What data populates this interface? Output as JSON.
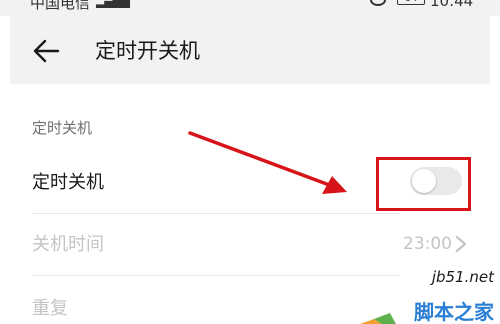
{
  "status_bar": {
    "carrier": "中国电信",
    "battery": "64",
    "time": "10:44"
  },
  "header": {
    "title": "定时开关机"
  },
  "section": {
    "title": "定时关机"
  },
  "rows": [
    {
      "label": "定时关机",
      "toggle_on": false
    },
    {
      "label": "关机时间",
      "value": "23:00"
    },
    {
      "label": "重复"
    }
  ],
  "watermark": {
    "site": "jb51.net",
    "name": "脚本之家"
  },
  "colors": {
    "annotation": "#d6141a",
    "watermark_text": "#2a7fd4"
  }
}
